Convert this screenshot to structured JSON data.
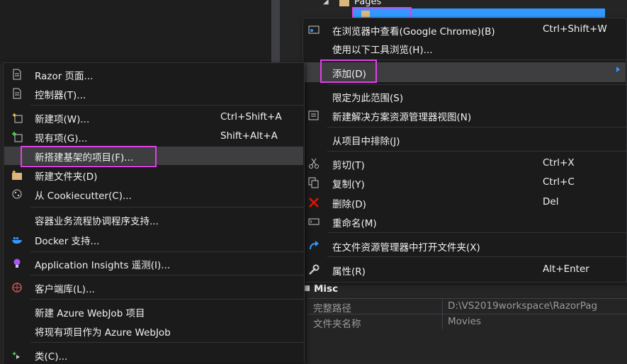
{
  "background": {
    "tree_folder_label": "Pages"
  },
  "context_menu": {
    "items": [
      {
        "label": "在浏览器中查看(Google Chrome)(B)",
        "shortcut": "Ctrl+Shift+W",
        "icon": "browser-icon"
      },
      {
        "label": "使用以下工具浏览(H)...",
        "shortcut": "",
        "icon": ""
      },
      {
        "label": "添加(D)",
        "shortcut": "",
        "icon": "",
        "submenu": true
      },
      {
        "label": "限定为此范围(S)",
        "shortcut": "",
        "icon": ""
      },
      {
        "label": "新建解决方案资源管理器视图(N)",
        "shortcut": "",
        "icon": "new-view-icon"
      },
      {
        "label": "从项目中排除(J)",
        "shortcut": "",
        "icon": ""
      },
      {
        "label": "剪切(T)",
        "shortcut": "Ctrl+X",
        "icon": "scissors-icon"
      },
      {
        "label": "复制(Y)",
        "shortcut": "Ctrl+C",
        "icon": "copy-icon"
      },
      {
        "label": "删除(D)",
        "shortcut": "Del",
        "icon": "delete-icon"
      },
      {
        "label": "重命名(M)",
        "shortcut": "",
        "icon": "rename-icon"
      },
      {
        "label": "在文件资源管理器中打开文件夹(X)",
        "shortcut": "",
        "icon": "refresh-arrow-icon"
      },
      {
        "label": "属性(R)",
        "shortcut": "Alt+Enter",
        "icon": "wrench-icon"
      }
    ]
  },
  "add_submenu": {
    "items": [
      {
        "label": "Razor 页面...",
        "shortcut": "",
        "icon": "page-icon"
      },
      {
        "label": "控制器(T)...",
        "shortcut": "",
        "icon": "page-icon"
      },
      {
        "label": "新建项(W)...",
        "shortcut": "Ctrl+Shift+A",
        "icon": "new-item-icon"
      },
      {
        "label": "现有项(G)...",
        "shortcut": "Shift+Alt+A",
        "icon": "existing-item-icon"
      },
      {
        "label": "新搭建基架的项目(F)...",
        "shortcut": "",
        "icon": ""
      },
      {
        "label": "新建文件夹(D)",
        "shortcut": "",
        "icon": "new-folder-icon"
      },
      {
        "label": "从 Cookiecutter(C)...",
        "shortcut": "",
        "icon": "cookiecutter-icon"
      },
      {
        "label": "容器业务流程协调程序支持...",
        "shortcut": "",
        "icon": ""
      },
      {
        "label": "Docker 支持...",
        "shortcut": "",
        "icon": "docker-icon"
      },
      {
        "label": "Application Insights 遥测(I)...",
        "shortcut": "",
        "icon": "insights-icon"
      },
      {
        "label": "客户端库(L)...",
        "shortcut": "",
        "icon": "client-library-icon"
      },
      {
        "label": "新建 Azure WebJob 项目",
        "shortcut": "",
        "icon": ""
      },
      {
        "label": "将现有项目作为 Azure WebJob",
        "shortcut": "",
        "icon": ""
      },
      {
        "label": "类(C)...",
        "shortcut": "",
        "icon": "class-icon"
      }
    ]
  },
  "properties": {
    "section": "Misc",
    "rows": [
      {
        "key": "完整路径",
        "value": "D:\\VS2019workspace\\RazorPag"
      },
      {
        "key": "文件夹名称",
        "value": "Movies"
      }
    ]
  },
  "colors": {
    "accent": "#3399ff",
    "highlight": "#e040e8",
    "menu_bg": "#1b1b1c"
  }
}
